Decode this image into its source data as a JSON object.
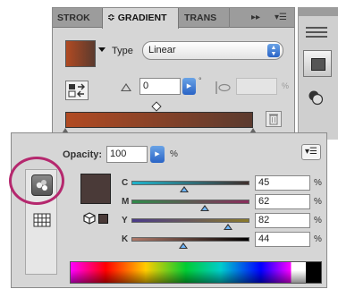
{
  "gradient_panel": {
    "tabs": [
      {
        "label": "STROK",
        "active": false
      },
      {
        "label": "≎ GRADIENT",
        "active": true
      },
      {
        "label": "TRANS",
        "active": false
      }
    ],
    "collapse_glyph": "▸▸",
    "menu_glyph": "▾☰",
    "type_label": "Type",
    "type_value": "Linear",
    "angle_value": "0",
    "angle_unit": "°",
    "aspect_unit": "%",
    "gradient_colors": [
      "#b14a22",
      "#5b3a2e"
    ]
  },
  "dock": {
    "icons": [
      "panel-grip-icon",
      "swatches-dock-icon",
      "appearance-dock-icon"
    ]
  },
  "color_panel": {
    "opacity_label": "Opacity:",
    "opacity_value": "100",
    "opacity_unit": "%",
    "menu_glyph": "▾☰",
    "fill_color": "#4a3a38",
    "channels": [
      {
        "letter": "C",
        "value": "45",
        "fraction": 0.45,
        "track_colors": [
          "#1fb4cc",
          "#402f2c"
        ]
      },
      {
        "letter": "M",
        "value": "62",
        "fraction": 0.62,
        "track_colors": [
          "#2f8a4a",
          "#8a2d5c"
        ]
      },
      {
        "letter": "Y",
        "value": "82",
        "fraction": 0.82,
        "track_colors": [
          "#4a3a8a",
          "#8a7a2a"
        ]
      },
      {
        "letter": "K",
        "value": "44",
        "fraction": 0.44,
        "track_colors": [
          "#b07a6a",
          "#000000"
        ]
      }
    ],
    "channel_unit": "%",
    "highlight_color": "#b5286e"
  }
}
